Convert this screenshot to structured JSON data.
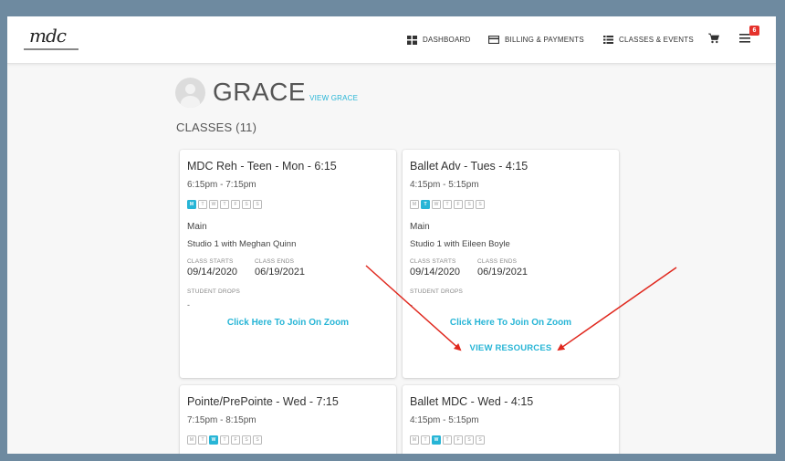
{
  "header": {
    "nav": [
      {
        "label": "DASHBOARD",
        "icon": "dashboard-icon"
      },
      {
        "label": "BILLING & PAYMENTS",
        "icon": "credit-card-icon"
      },
      {
        "label": "CLASSES & EVENTS",
        "icon": "list-icon"
      }
    ],
    "cart_icon": "cart-icon",
    "menu_icon": "hamburger-menu-icon",
    "notification_count": "6"
  },
  "profile": {
    "name": "GRACE",
    "view_link": "VIEW GRACE"
  },
  "classes_title": "CLASSES (11)",
  "day_letters": [
    "M",
    "T",
    "W",
    "T",
    "F",
    "S",
    "S"
  ],
  "cards": [
    {
      "title": "MDC Reh - Teen - Mon - 6:15",
      "time": "6:15pm - 7:15pm",
      "active_day": 0,
      "location": "Main",
      "studio": "Studio 1 with Meghan Quinn",
      "starts_label": "CLASS STARTS",
      "ends_label": "CLASS ENDS",
      "starts": "09/14/2020",
      "ends": "06/19/2021",
      "drops_label": "STUDENT DROPS",
      "drops": "-",
      "zoom_link": "Click Here To Join On Zoom",
      "resources_link": ""
    },
    {
      "title": "Ballet Adv - Tues - 4:15",
      "time": "4:15pm - 5:15pm",
      "active_day": 1,
      "location": "Main",
      "studio": "Studio 1 with Eileen Boyle",
      "starts_label": "CLASS STARTS",
      "ends_label": "CLASS ENDS",
      "starts": "09/14/2020",
      "ends": "06/19/2021",
      "drops_label": "STUDENT DROPS",
      "drops": "-",
      "zoom_link": "Click Here To Join On Zoom",
      "resources_link": "VIEW RESOURCES"
    },
    {
      "title": "Pointe/PrePointe - Wed - 7:15",
      "time": "7:15pm - 8:15pm",
      "active_day": 2
    },
    {
      "title": "Ballet MDC - Wed - 4:15",
      "time": "4:15pm - 5:15pm",
      "active_day": 2
    }
  ],
  "colors": {
    "accent": "#27b5d6",
    "arrow": "#e0281e",
    "badge": "#e5322c"
  }
}
